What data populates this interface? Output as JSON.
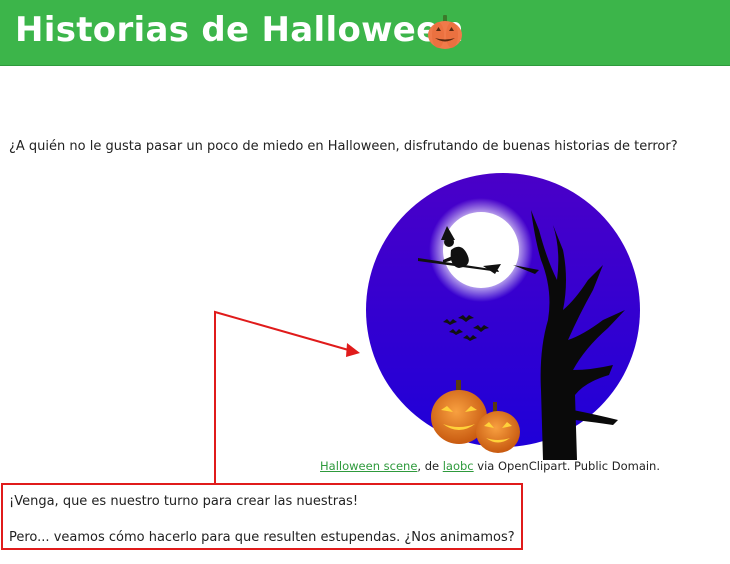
{
  "header": {
    "title": "Historias de Halloween",
    "emoji_icon": "jack-o-lantern-icon",
    "background": "#3cb54a"
  },
  "intro": "¿A quién no le gusta pasar un poco de miedo en Halloween, disfrutando de buenas historias de terror?",
  "image": {
    "icon": "halloween-scene-image",
    "caption": {
      "link1": "Halloween scene",
      "text1": ", de ",
      "link2": "laobc",
      "text2": " via OpenClipart. Public Domain."
    }
  },
  "highlight": {
    "para1": "¡Venga, que es nuestro turno para crear las nuestras!",
    "para2": "Pero... veamos cómo hacerlo para que resulten estupendas. ¿Nos animamos?",
    "color": "#e01b1b"
  }
}
